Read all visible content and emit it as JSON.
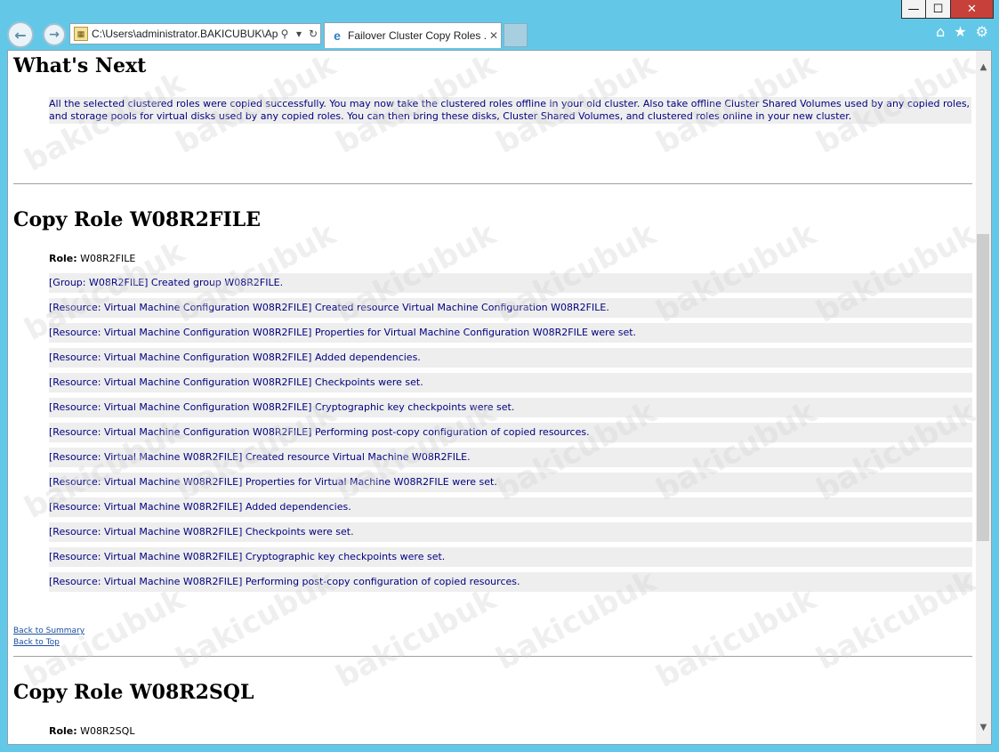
{
  "window": {
    "minimize": "—",
    "maximize": "☐",
    "close": "✕"
  },
  "toolbar": {
    "address": "C:\\Users\\administrator.BAKICUBUK\\Ap",
    "search_icon": "search-icon",
    "refresh_icon": "refresh-icon",
    "tab_title": "Failover Cluster Copy Roles ...",
    "tab_close": "✕",
    "icons": {
      "home": "⌂",
      "favorites": "★",
      "settings": "⚙"
    }
  },
  "page": {
    "whats_next": {
      "heading": "What's Next",
      "text": "All the selected clustered roles were copied successfully. You may now take the clustered roles offline in your old cluster. Also take offline Cluster Shared Volumes used by any copied roles, and storage pools for virtual disks used by any copied roles. You can then bring these disks, Cluster Shared Volumes, and clustered roles online in your new cluster."
    },
    "role1": {
      "heading": "Copy Role W08R2FILE",
      "role_label": "Role:",
      "role_value": "W08R2FILE",
      "rows": [
        "[Group: W08R2FILE] Created group W08R2FILE.",
        "[Resource: Virtual Machine Configuration W08R2FILE] Created resource Virtual Machine Configuration W08R2FILE.",
        "[Resource: Virtual Machine Configuration W08R2FILE] Properties for Virtual Machine Configuration W08R2FILE were set.",
        "[Resource: Virtual Machine Configuration W08R2FILE] Added dependencies.",
        "[Resource: Virtual Machine Configuration W08R2FILE] Checkpoints were set.",
        "[Resource: Virtual Machine Configuration W08R2FILE] Cryptographic key checkpoints were set.",
        "[Resource: Virtual Machine Configuration W08R2FILE] Performing post-copy configuration of copied resources.",
        "[Resource: Virtual Machine W08R2FILE] Created resource Virtual Machine W08R2FILE.",
        "[Resource: Virtual Machine W08R2FILE] Properties for Virtual Machine W08R2FILE were set.",
        "[Resource: Virtual Machine W08R2FILE] Added dependencies.",
        "[Resource: Virtual Machine W08R2FILE] Checkpoints were set.",
        "[Resource: Virtual Machine W08R2FILE] Cryptographic key checkpoints were set.",
        "[Resource: Virtual Machine W08R2FILE] Performing post-copy configuration of copied resources."
      ]
    },
    "links": {
      "back_to_summary": "Back to Summary",
      "back_to_top": "Back to Top"
    },
    "role2": {
      "heading": "Copy Role W08R2SQL",
      "role_label": "Role:",
      "role_value": "W08R2SQL"
    },
    "watermark": "bakicubuk"
  }
}
